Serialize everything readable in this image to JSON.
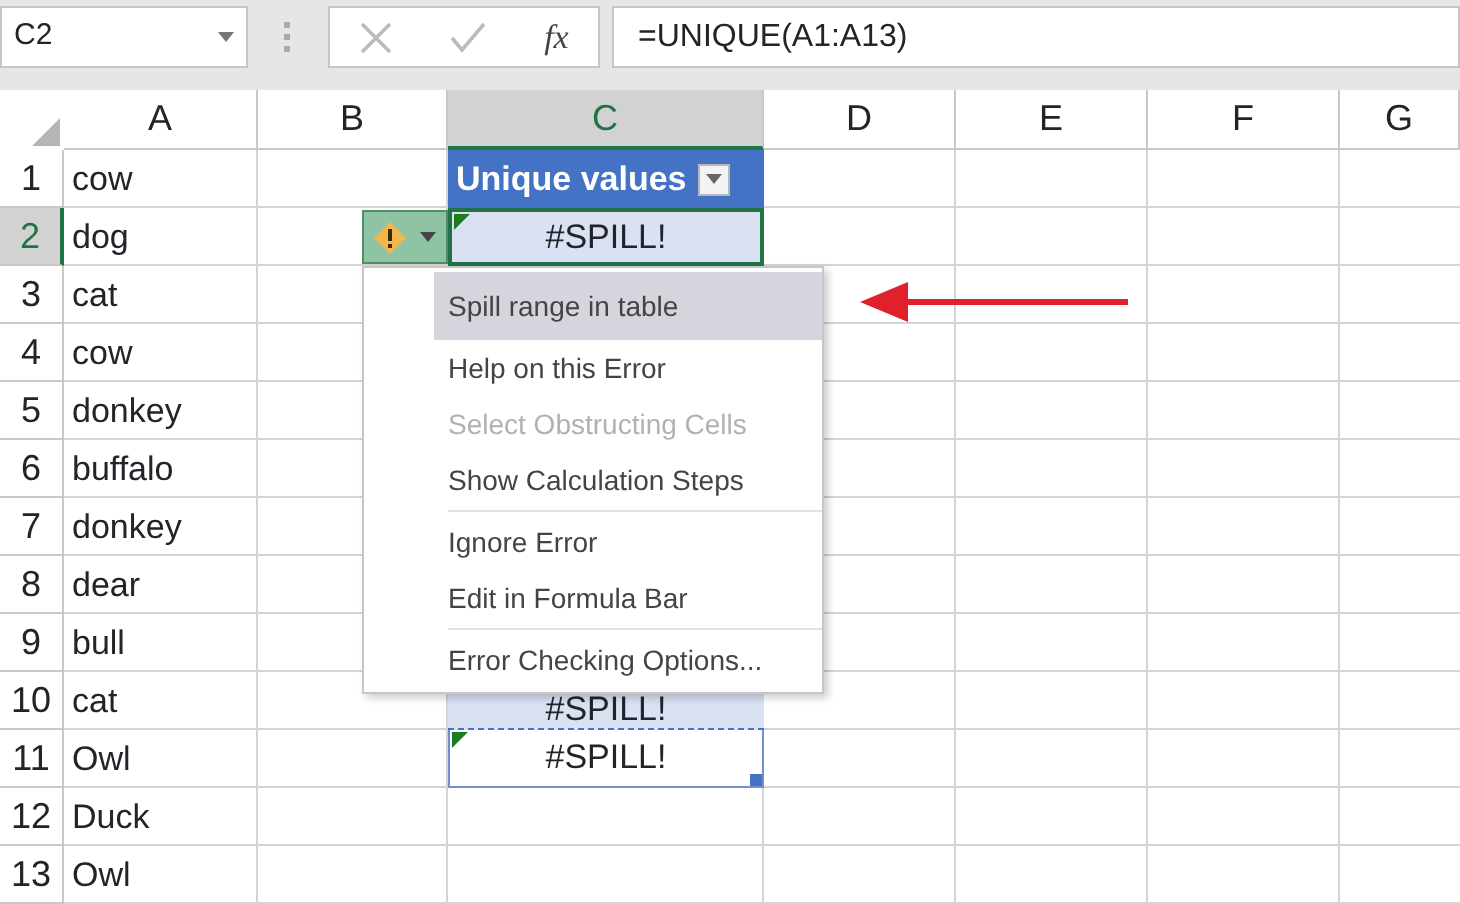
{
  "formula_bar": {
    "name_box": "C2",
    "fx": "fx",
    "formula": "=UNIQUE(A1:A13)"
  },
  "columns": [
    {
      "label": "A",
      "selected": false
    },
    {
      "label": "B",
      "selected": false
    },
    {
      "label": "C",
      "selected": true
    },
    {
      "label": "D",
      "selected": false
    },
    {
      "label": "E",
      "selected": false
    },
    {
      "label": "F",
      "selected": false
    },
    {
      "label": "G",
      "selected": false
    }
  ],
  "rows": [
    {
      "header": "1",
      "selected": false,
      "column_a": "cow",
      "column_c": {
        "kind": "table_header",
        "text": "Unique values",
        "selected": false,
        "error_flag": false
      }
    },
    {
      "header": "2",
      "selected": true,
      "column_a": "dog",
      "column_c": {
        "kind": "spill",
        "text": "#SPILL!",
        "selected": true,
        "error_flag": true
      }
    },
    {
      "header": "3",
      "selected": false,
      "column_a": "cat"
    },
    {
      "header": "4",
      "selected": false,
      "column_a": "cow"
    },
    {
      "header": "5",
      "selected": false,
      "column_a": "donkey"
    },
    {
      "header": "6",
      "selected": false,
      "column_a": "buffalo"
    },
    {
      "header": "7",
      "selected": false,
      "column_a": "donkey"
    },
    {
      "header": "8",
      "selected": false,
      "column_a": "dear"
    },
    {
      "header": "9",
      "selected": false,
      "column_a": "bull"
    },
    {
      "header": "10",
      "selected": false,
      "column_a": "cat",
      "column_c": {
        "kind": "spill",
        "text": "#SPILL!",
        "selected": false,
        "error_flag": false
      }
    },
    {
      "header": "11",
      "selected": false,
      "column_a": "Owl",
      "column_c": {
        "kind": "spill_edge",
        "text": "#SPILL!",
        "selected": false,
        "error_flag": true
      }
    },
    {
      "header": "12",
      "selected": false,
      "column_a": "Duck"
    },
    {
      "header": "13",
      "selected": false,
      "column_a": "Owl"
    }
  ],
  "error_menu": {
    "groups": [
      [
        {
          "label": "Spill range in table",
          "selected": true,
          "disabled": false
        },
        {
          "label": "Help on this Error",
          "selected": false,
          "disabled": false
        },
        {
          "label": "Select Obstructing Cells",
          "selected": false,
          "disabled": true
        },
        {
          "label": "Show Calculation Steps",
          "selected": false,
          "disabled": false
        }
      ],
      [
        {
          "label": "Ignore Error",
          "selected": false,
          "disabled": false
        },
        {
          "label": "Edit in Formula Bar",
          "selected": false,
          "disabled": false
        }
      ],
      [
        {
          "label": "Error Checking Options...",
          "selected": false,
          "disabled": false
        }
      ]
    ]
  }
}
